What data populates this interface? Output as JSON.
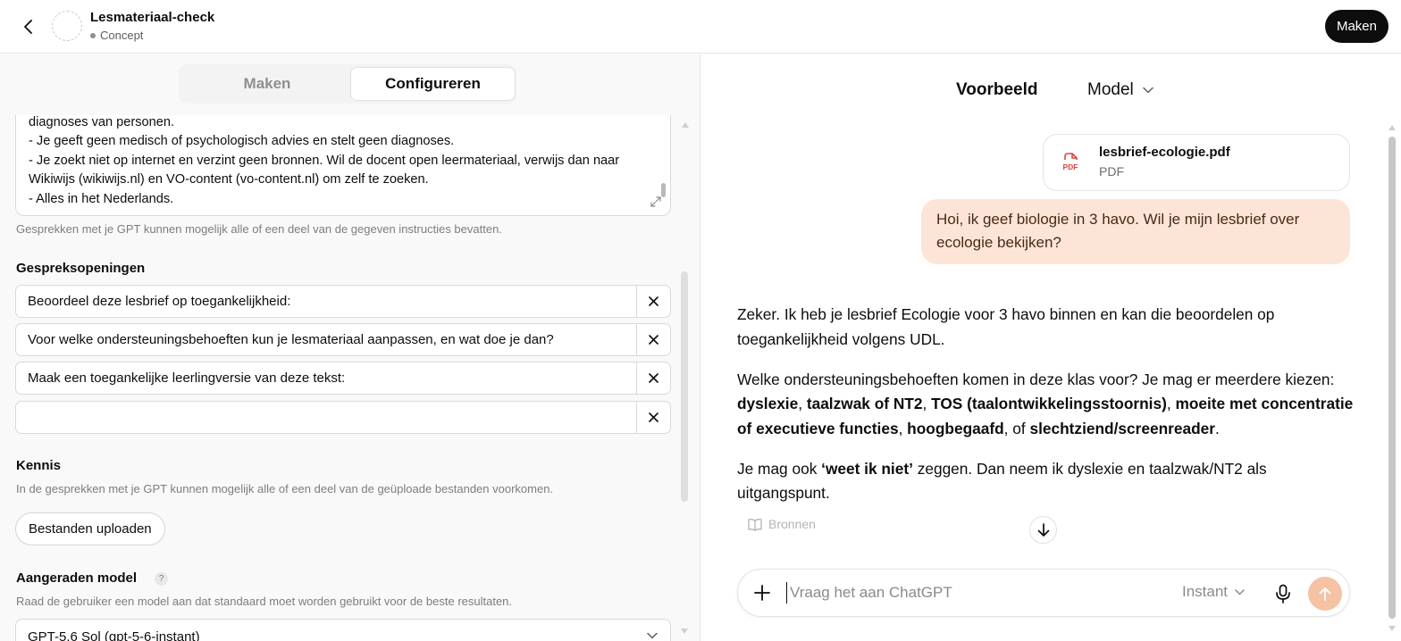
{
  "header": {
    "gpt_name": "Lesmateriaal-check",
    "status": "Concept",
    "make_button": "Maken"
  },
  "tabs": {
    "make": "Maken",
    "configure": "Configureren",
    "active": "Configureren"
  },
  "instructions": {
    "visible_text": "diagnoses van personen.\n- Je geeft geen medisch of psychologisch advies en stelt geen diagnoses.\n- Je zoekt niet op internet en verzint geen bronnen. Wil de docent open leermateriaal, verwijs dan naar Wikiwijs (wikiwijs.nl) en VO-content (vo-content.nl) om zelf te zoeken.\n- Alles in het Nederlands.",
    "hint": "Gesprekken met je GPT kunnen mogelijk alle of een deel van de gegeven instructies bevatten."
  },
  "conversation_starters": {
    "title": "Gespreksopeningen",
    "items": [
      "Beoordeel deze lesbrief op toegankelijkheid:",
      "Voor welke ondersteuningsbehoeften kun je lesmateriaal aanpassen, en wat doe je dan?",
      "Maak een toegankelijke leerlingversie van deze tekst:",
      ""
    ]
  },
  "knowledge": {
    "title": "Kennis",
    "subtitle": "In de gesprekken met je GPT kunnen mogelijk alle of een deel van de geüploade bestanden voorkomen.",
    "upload_button": "Bestanden uploaden"
  },
  "recommended_model": {
    "title": "Aangeraden model",
    "help": "?",
    "subtitle": "Raad de gebruiker een model aan dat standaard moet worden gebruikt voor de beste resultaten.",
    "selected": "GPT-5.6 Sol (gpt-5-6-instant)"
  },
  "preview": {
    "title": "Voorbeeld",
    "model_menu": "Model",
    "file": {
      "name": "lesbrief-ecologie.pdf",
      "type": "PDF",
      "badge": "PDF"
    },
    "user_message": "Hoi, ik geef biologie in 3 havo. Wil je mijn lesbrief over ecologie bekijken?",
    "assistant": {
      "p1": "Zeker. Ik heb je lesbrief Ecologie voor 3 havo binnen en kan die beoordelen op toegankelijkheid volgens UDL.",
      "p2_intro": "Welke ondersteuningsbehoeften komen in deze klas voor? Je mag er meerdere kiezen: ",
      "p2_opt1": "dyslexie",
      "p2_opt2": "taalzwak of NT2",
      "p2_opt3": "TOS (taalontwikkelingsstoornis)",
      "p2_opt4": "moeite met concentratie of executieve functies",
      "p2_opt5": "hoogbegaafd",
      "p2_or": ", of ",
      "p2_opt6": "slechtziend/screenreader",
      "p3_pre": "Je mag ook ",
      "p3_bold": "‘weet ik niet’",
      "p3_post": " zeggen. Dan neem ik dyslexie en taalzwak/NT2 als uitgangspunt."
    },
    "sources_label": "Bronnen",
    "composer": {
      "placeholder": "Vraag het aan ChatGPT",
      "mode": "Instant"
    }
  },
  "colors": {
    "user_bubble": "#fce5d6",
    "send_button": "#f6c2a4",
    "primary_button": "#0d0d0d"
  }
}
